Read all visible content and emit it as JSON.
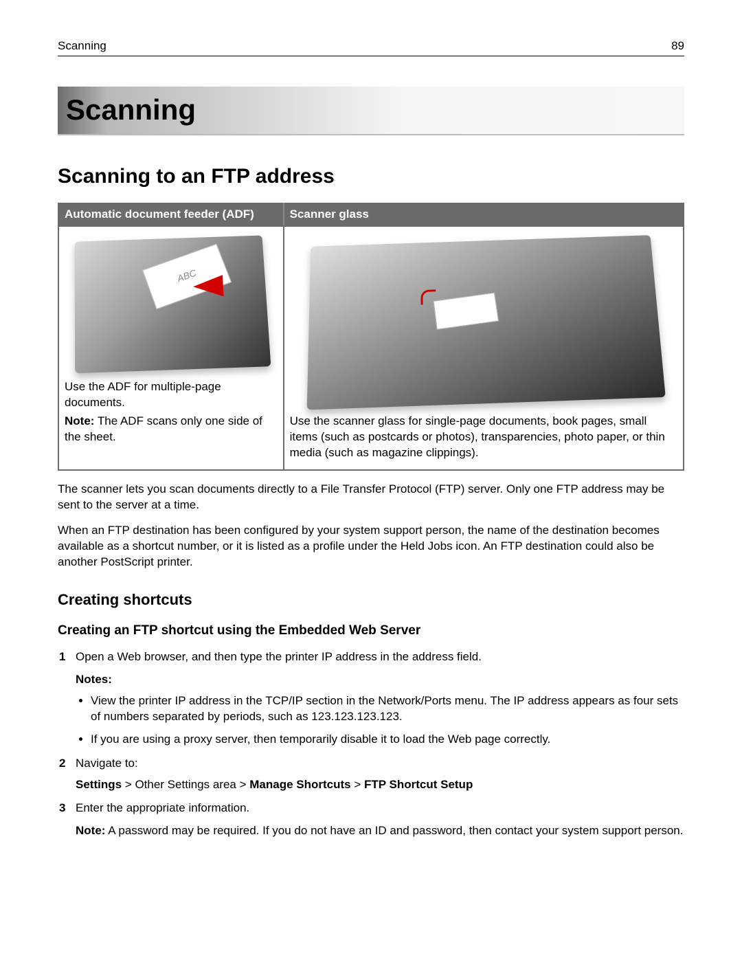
{
  "header": {
    "running_title": "Scanning",
    "page_number": "89"
  },
  "chapter": {
    "title": "Scanning"
  },
  "section": {
    "title": "Scanning to an FTP address"
  },
  "table": {
    "headers": {
      "adf": "Automatic document feeder (ADF)",
      "glass": "Scanner glass"
    },
    "adf_cell": {
      "image_alt": "printer-adf-illustration",
      "paper_label": "ABC",
      "line1": "Use the ADF for multiple‑page documents.",
      "note_label": "Note:",
      "note_text": " The ADF scans only one side of the sheet."
    },
    "glass_cell": {
      "image_alt": "scanner-glass-illustration",
      "line1": "Use the scanner glass for single‑page documents, book pages, small items (such as postcards or photos), transparencies, photo paper, or thin media (such as magazine clippings)."
    }
  },
  "body": {
    "p1": "The scanner lets you scan documents directly to a File Transfer Protocol (FTP) server. Only one FTP address may be sent to the server at a time.",
    "p2": "When an FTP destination has been configured by your system support person, the name of the destination becomes available as a shortcut number, or it is listed as a profile under the Held Jobs icon. An FTP destination could also be another PostScript printer."
  },
  "subsection": {
    "title": "Creating shortcuts"
  },
  "subsubsection": {
    "title": "Creating an FTP shortcut using the Embedded Web Server"
  },
  "steps": {
    "s1": {
      "text": "Open a Web browser, and then type the printer IP address in the address field.",
      "notes_label": "Notes:",
      "bullet1": "View the printer IP address in the TCP/IP section in the Network/Ports menu. The IP address appears as four sets of numbers separated by periods, such as 123.123.123.123.",
      "bullet2": "If you are using a proxy server, then temporarily disable it to load the Web page correctly."
    },
    "s2": {
      "text": "Navigate to:",
      "path_bold1": "Settings",
      "path_sep1": " > ",
      "path_plain": "Other Settings area",
      "path_sep2": " > ",
      "path_bold2": "Manage Shortcuts",
      "path_sep3": " > ",
      "path_bold3": "FTP Shortcut Setup"
    },
    "s3": {
      "text": "Enter the appropriate information.",
      "note_label": "Note:",
      "note_text": " A password may be required. If you do not have an ID and password, then contact your system support person."
    }
  }
}
